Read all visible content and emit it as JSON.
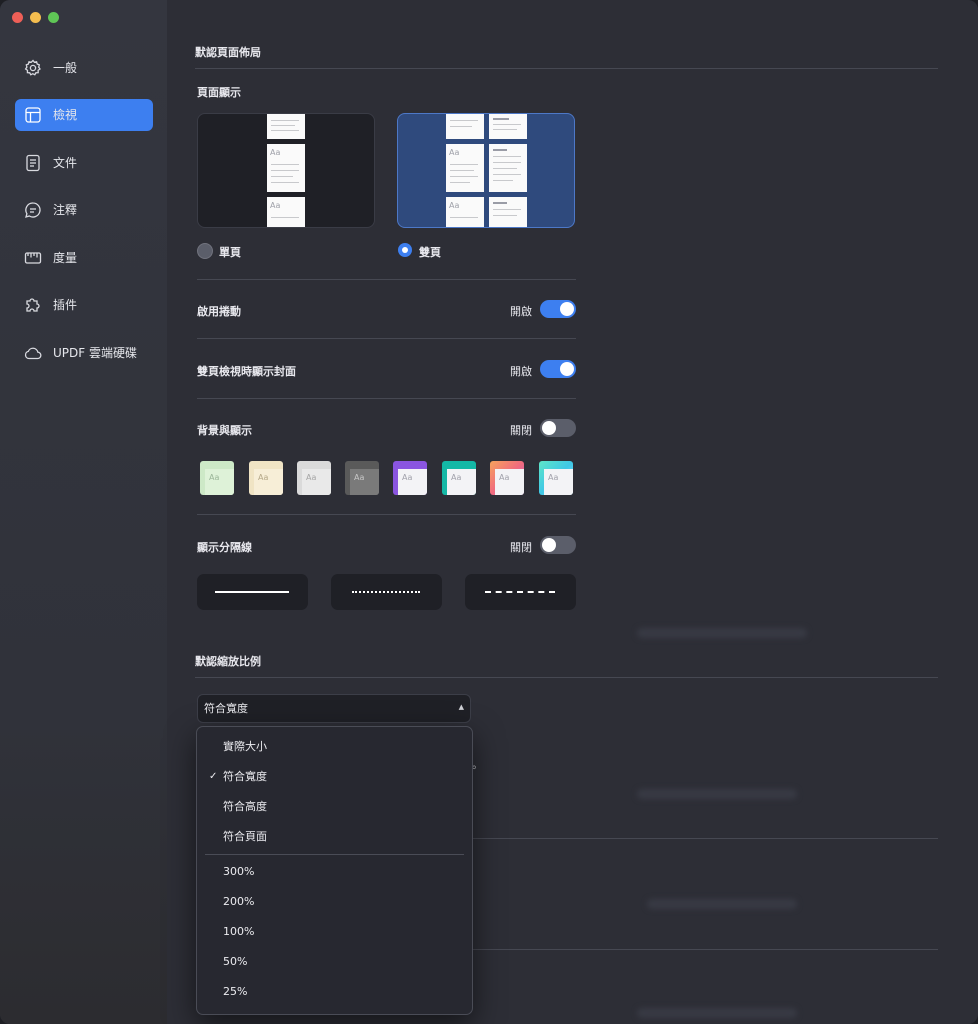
{
  "window": {
    "traffic_colors": [
      "#ee5f57",
      "#f4bd4f",
      "#5fc656"
    ]
  },
  "sidebar": {
    "items": [
      {
        "label": "一般",
        "icon": "gear-icon"
      },
      {
        "label": "檢視",
        "icon": "layout-icon",
        "active": true
      },
      {
        "label": "文件",
        "icon": "document-icon"
      },
      {
        "label": "注釋",
        "icon": "comment-icon"
      },
      {
        "label": "度量",
        "icon": "ruler-icon"
      },
      {
        "label": "插件",
        "icon": "puzzle-icon"
      },
      {
        "label": "UPDF 雲端硬碟",
        "icon": "cloud-icon"
      }
    ]
  },
  "main": {
    "layout_section": {
      "title": "默認頁面佈局",
      "page_display": "頁面顯示",
      "single_label": "單頁",
      "double_label": "雙頁",
      "thumb_text": "Aa"
    },
    "settings": {
      "scroll": {
        "label": "啟用捲動",
        "state": "開啟"
      },
      "cover": {
        "label": "雙頁檢視時顯示封面",
        "state": "開啟"
      },
      "background": {
        "label": "背景與顯示",
        "state": "關閉"
      },
      "divider": {
        "label": "顯示分隔線",
        "state": "關閉"
      }
    },
    "swatch_colors": [
      "#cde9c7",
      "#f0e4c4",
      "#dadada",
      "#6a6a6a",
      "#8a55e0",
      "#14b8a6",
      "#f06a7e",
      "#3fc7e6"
    ],
    "zoom_section": {
      "title": "默認縮放比例",
      "selected": "符合寬度"
    },
    "dropdown": {
      "options_a": [
        "實際大小",
        "符合寬度",
        "符合高度",
        "符合頁面"
      ],
      "options_b": [
        "300%",
        "200%",
        "100%",
        "50%",
        "25%"
      ],
      "check": "✓",
      "peek_text": "。"
    }
  },
  "colors": {
    "accent": "#3d7ff0"
  }
}
